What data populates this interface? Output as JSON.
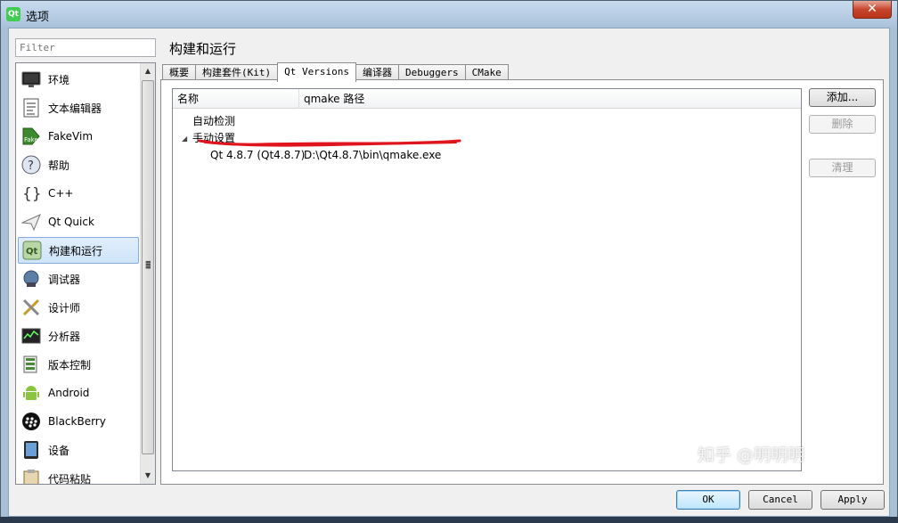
{
  "window": {
    "title": "选项",
    "app_icon": "qt-logo-icon",
    "close_label": "✕"
  },
  "filter": {
    "placeholder": "Filter"
  },
  "sidebar": {
    "items": [
      {
        "label": "环境",
        "icon": "monitor-icon",
        "selected": false
      },
      {
        "label": "文本编辑器",
        "icon": "text-document-icon",
        "selected": false
      },
      {
        "label": "FakeVim",
        "icon": "fakevim-icon",
        "selected": false
      },
      {
        "label": "帮助",
        "icon": "help-icon",
        "selected": false
      },
      {
        "label": "C++",
        "icon": "braces-icon",
        "selected": false
      },
      {
        "label": "Qt Quick",
        "icon": "paper-plane-icon",
        "selected": false
      },
      {
        "label": "构建和运行",
        "icon": "qt-build-icon",
        "selected": true
      },
      {
        "label": "调试器",
        "icon": "debugger-icon",
        "selected": false
      },
      {
        "label": "设计师",
        "icon": "designer-tools-icon",
        "selected": false
      },
      {
        "label": "分析器",
        "icon": "analyzer-icon",
        "selected": false
      },
      {
        "label": "版本控制",
        "icon": "version-control-icon",
        "selected": false
      },
      {
        "label": "Android",
        "icon": "android-icon",
        "selected": false
      },
      {
        "label": "BlackBerry",
        "icon": "blackberry-icon",
        "selected": false
      },
      {
        "label": "设备",
        "icon": "device-icon",
        "selected": false
      },
      {
        "label": "代码粘贴",
        "icon": "code-paste-icon",
        "selected": false
      }
    ]
  },
  "main": {
    "page_title": "构建和运行",
    "tabs": [
      {
        "label": "概要",
        "active": false
      },
      {
        "label": "构建套件(Kit)",
        "active": false
      },
      {
        "label": "Qt Versions",
        "active": true
      },
      {
        "label": "编译器",
        "active": false
      },
      {
        "label": "Debuggers",
        "active": false
      },
      {
        "label": "CMake",
        "active": false
      }
    ],
    "tree": {
      "columns": [
        "名称",
        "qmake 路径"
      ],
      "rows": {
        "auto": {
          "name": "自动检测"
        },
        "manual": {
          "name": "手动设置",
          "expanded": true
        },
        "version": {
          "name": "Qt 4.8.7 (Qt4.8.7)",
          "path": "D:\\Qt4.8.7\\bin\\qmake.exe"
        }
      }
    },
    "buttons": {
      "add": "添加...",
      "remove": "删除",
      "clean": "清理"
    }
  },
  "footer": {
    "ok": "OK",
    "cancel": "Cancel",
    "apply": "Apply"
  },
  "watermark": "知乎 @明明明",
  "colors": {
    "annotation_red": "#e0141c",
    "selected_bg": "#cfe4f9",
    "qt_green": "#41cd52"
  }
}
